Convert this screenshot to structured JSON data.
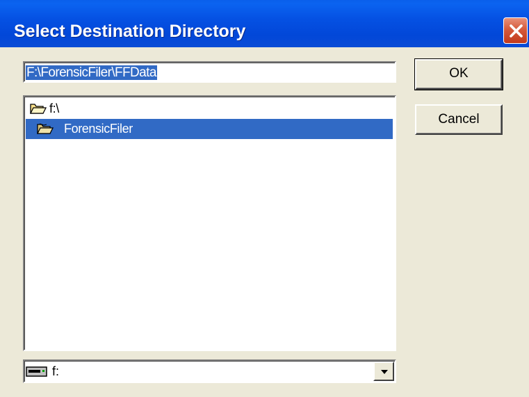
{
  "window": {
    "title": "Select Destination Directory"
  },
  "path_field": {
    "value": "F:\\ForensicFiler\\FFData"
  },
  "buttons": {
    "ok_label": "OK",
    "cancel_label": "Cancel"
  },
  "directory_list": {
    "items": [
      {
        "label": "f:\\",
        "icon": "open-folder-icon",
        "selected": false
      },
      {
        "label": "ForensicFiler",
        "icon": "open-folder-icon",
        "selected": true
      }
    ]
  },
  "drive_select": {
    "selected": "f:",
    "icon": "drive-icon"
  },
  "colors": {
    "titlebar": "#0247D8",
    "selection": "#316AC5",
    "dialog_bg": "#ECE9D8",
    "close_button": "#D55A3C"
  }
}
